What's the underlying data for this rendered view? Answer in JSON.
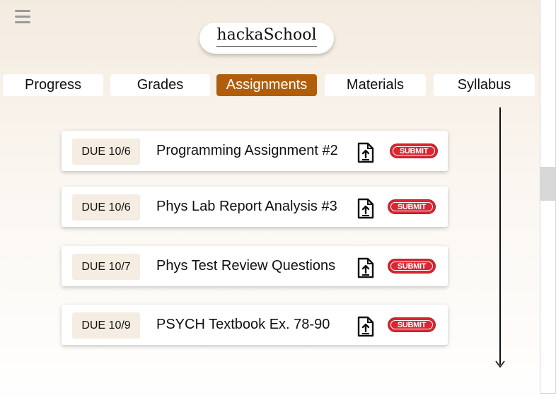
{
  "app": {
    "logo_text": "hackaSchool"
  },
  "tabs": [
    {
      "label": "Progress",
      "active": false
    },
    {
      "label": "Grades",
      "active": false
    },
    {
      "label": "Assignments",
      "active": true
    },
    {
      "label": "Materials",
      "active": false
    },
    {
      "label": "Syllabus",
      "active": false
    }
  ],
  "assignments": [
    {
      "due": "DUE 10/6",
      "title": "Programming Assignment #2",
      "submit_label": "SUBMIT",
      "upload_icon": "file-upload-icon"
    },
    {
      "due": "DUE 10/6",
      "title": "Phys Lab Report Analysis #3",
      "submit_label": "SUBMIT",
      "upload_icon": "file-upload-icon"
    },
    {
      "due": "DUE 10/7",
      "title": "Phys Test Review Questions",
      "submit_label": "SUBMIT",
      "upload_icon": "file-upload-icon"
    },
    {
      "due": "DUE 10/9",
      "title": "PSYCH Textbook Ex. 78-90",
      "submit_label": "SUBMIT",
      "upload_icon": "file-upload-icon"
    }
  ],
  "colors": {
    "accent": "#b05e0c",
    "submit": "#d92630",
    "due_badge": "#f5ece2"
  }
}
